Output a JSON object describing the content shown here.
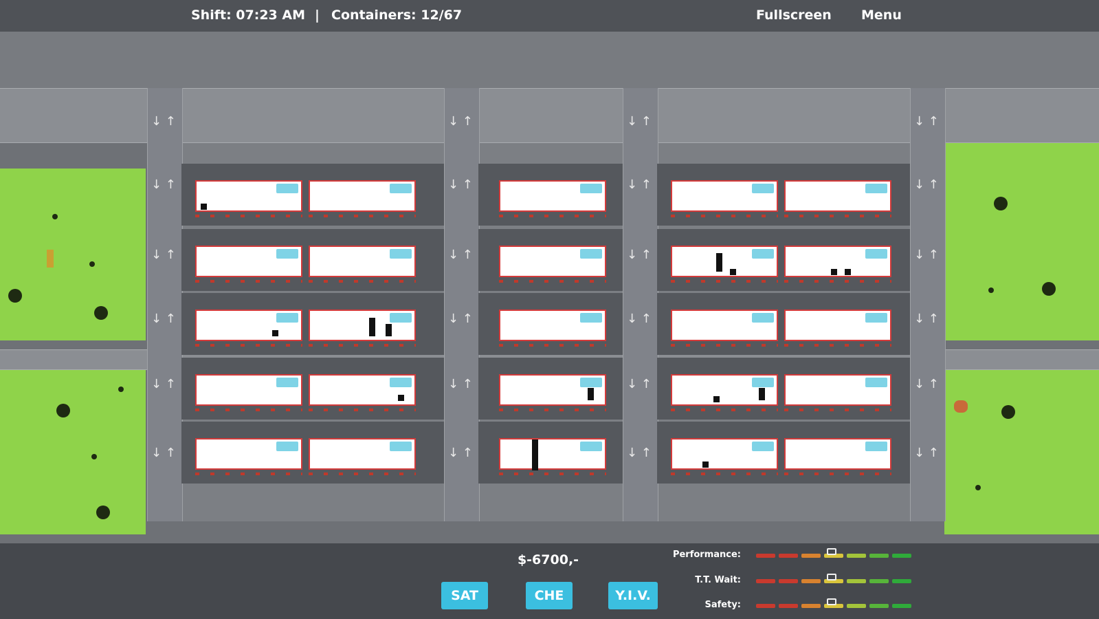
{
  "topbar": {
    "shift": "Shift: 07:23 AM",
    "separator": "|",
    "containers": "Containers: 12/67",
    "fullscreen_label": "Fullscreen",
    "menu_label": "Menu"
  },
  "footer": {
    "money": "$-6700,-",
    "buttons": [
      "SAT",
      "CHE",
      "Y.I.V."
    ],
    "stats": [
      {
        "label": "Performance:",
        "level": 0.48
      },
      {
        "label": "T.T. Wait:",
        "level": 0.48
      },
      {
        "label": "Safety:",
        "level": 0.48
      }
    ],
    "meter_colors": [
      "#c93a2e",
      "#c93a2e",
      "#d8822f",
      "#d9c53c",
      "#a3c43a",
      "#57b43a",
      "#2faa3a"
    ]
  },
  "colors": {
    "grass": "#8fd34a",
    "bay_border": "#d43a3a",
    "button": "#3bbfe0"
  }
}
